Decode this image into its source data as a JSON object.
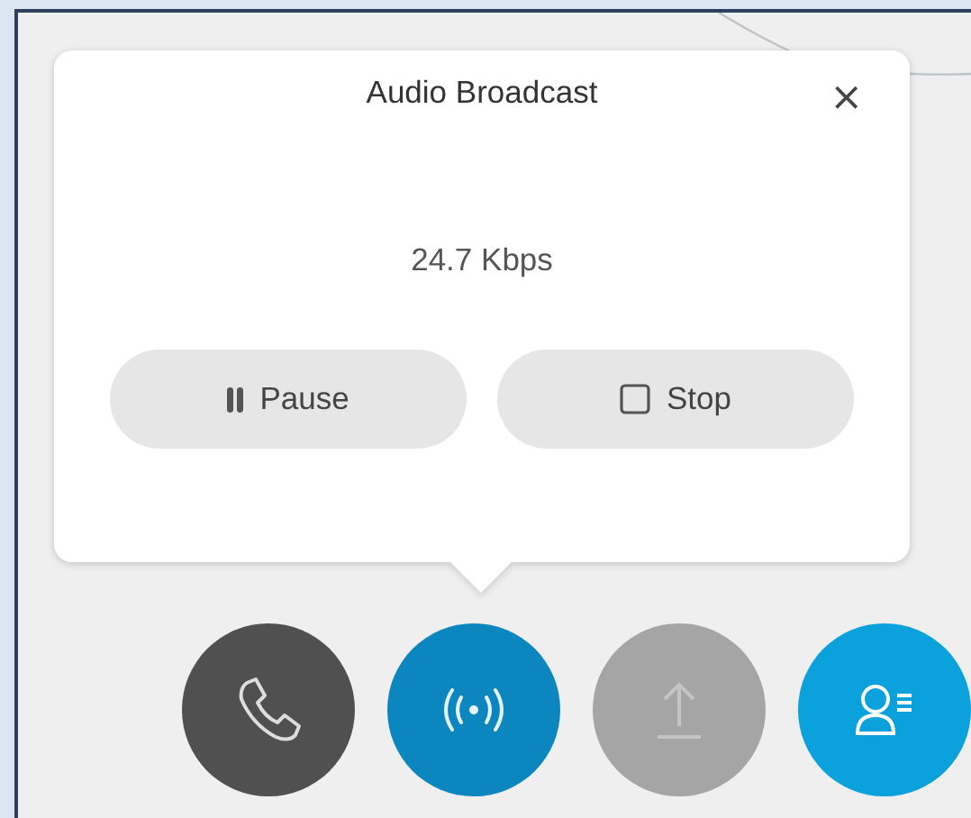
{
  "popup": {
    "title": "Audio Broadcast",
    "close": "×",
    "rate": "24.7 Kbps",
    "buttons": [
      {
        "kind": "pause",
        "label": "Pause"
      },
      {
        "kind": "stop",
        "label": "Stop"
      }
    ]
  },
  "controls": [
    {
      "kind": "phone",
      "disabled": false
    },
    {
      "kind": "broadcast",
      "disabled": false
    },
    {
      "kind": "upload",
      "disabled": true
    },
    {
      "kind": "participants",
      "disabled": false
    }
  ]
}
